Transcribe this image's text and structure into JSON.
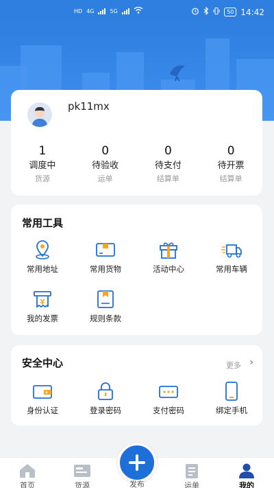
{
  "status_bar": {
    "left_a": "HD",
    "left_b": "HD",
    "net1": "4G",
    "net2": "5G",
    "battery": "50",
    "time": "14:42"
  },
  "profile": {
    "username": "pk11mx"
  },
  "stats": [
    {
      "count": "1",
      "label": "调度中",
      "sub": "货源"
    },
    {
      "count": "0",
      "label": "待验收",
      "sub": "运单"
    },
    {
      "count": "0",
      "label": "待支付",
      "sub": "结算单"
    },
    {
      "count": "0",
      "label": "待开票",
      "sub": "结算单"
    }
  ],
  "tools": {
    "title": "常用工具",
    "items": [
      {
        "label": "常用地址",
        "icon": "location-pin-icon"
      },
      {
        "label": "常用货物",
        "icon": "cargo-box-icon"
      },
      {
        "label": "活动中心",
        "icon": "gift-icon"
      },
      {
        "label": "常用车辆",
        "icon": "truck-icon"
      },
      {
        "label": "我的发票",
        "icon": "receipt-icon"
      },
      {
        "label": "规则条款",
        "icon": "rules-book-icon"
      }
    ]
  },
  "safety": {
    "title": "安全中心",
    "more": "更多",
    "items": [
      {
        "label": "身份认证",
        "icon": "wallet-id-icon"
      },
      {
        "label": "登录密码",
        "icon": "lock-icon"
      },
      {
        "label": "支付密码",
        "icon": "password-card-icon"
      },
      {
        "label": "绑定手机",
        "icon": "phone-icon"
      }
    ]
  },
  "nav": {
    "home": "首页",
    "goods": "货源",
    "publish": "发布",
    "waybill": "运单",
    "mine": "我的"
  },
  "colors": {
    "primary": "#1f6fd8",
    "header": "#2f7fe0"
  }
}
